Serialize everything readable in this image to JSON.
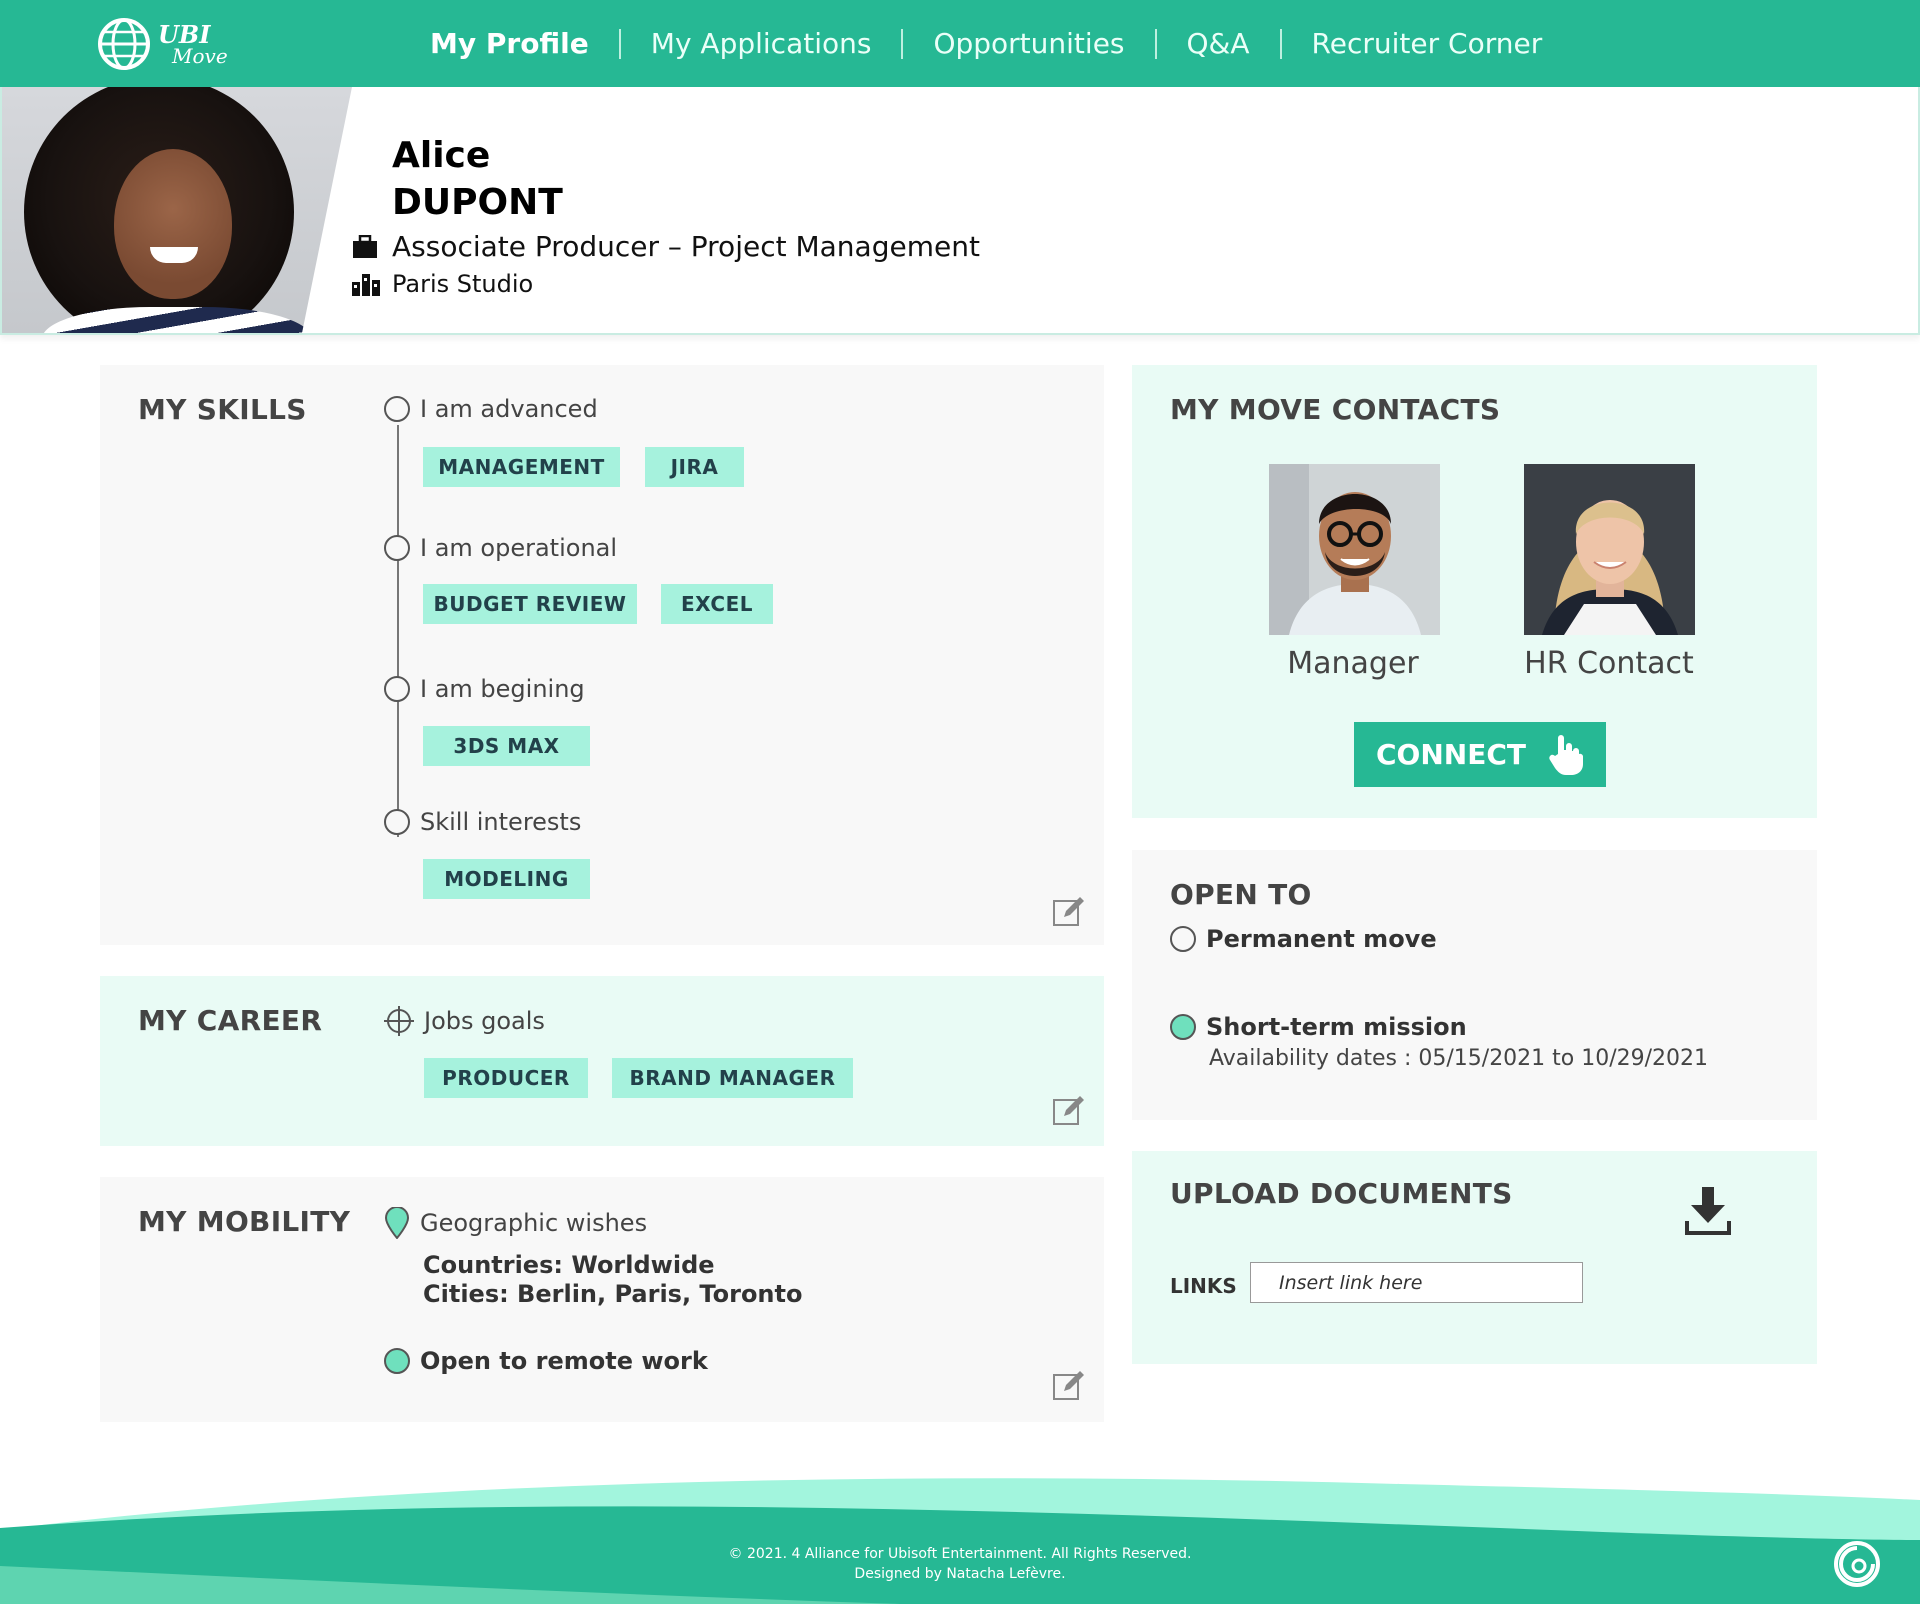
{
  "brand": {
    "logo_line1": "UBI",
    "logo_line2": "Move"
  },
  "nav": {
    "items": [
      "My Profile",
      "My Applications",
      "Opportunities",
      "Q&A",
      "Recruiter Corner"
    ]
  },
  "profile": {
    "first_name": "Alice",
    "last_name": "DUPONT",
    "role": "Associate Producer – Project Management",
    "studio": "Paris Studio"
  },
  "skills": {
    "title": "MY SKILLS",
    "levels": [
      {
        "label": "I am advanced",
        "tags": [
          "MANAGEMENT",
          "JIRA"
        ]
      },
      {
        "label": "I am operational",
        "tags": [
          "BUDGET REVIEW",
          "EXCEL"
        ]
      },
      {
        "label": "I am begining",
        "tags": [
          "3DS MAX"
        ]
      },
      {
        "label": "Skill interests",
        "tags": [
          "MODELING"
        ]
      }
    ]
  },
  "career": {
    "title": "MY CAREER",
    "goal_label": "Jobs goals",
    "tags": [
      "PRODUCER",
      "BRAND MANAGER"
    ]
  },
  "mobility": {
    "title": "MY MOBILITY",
    "geo_label": "Geographic wishes",
    "countries": "Countries: Worldwide",
    "cities": "Cities: Berlin, Paris, Toronto",
    "remote": "Open to remote work"
  },
  "contacts": {
    "title": "MY MOVE CONTACTS",
    "people": [
      {
        "label": "Manager"
      },
      {
        "label": "HR Contact"
      }
    ],
    "connect_label": "CONNECT"
  },
  "open_to": {
    "title": "OPEN TO",
    "permanent": "Permanent move",
    "short_term": "Short-term mission",
    "availability": "Availability dates : 05/15/2021 to 10/29/2021"
  },
  "upload": {
    "title": "UPLOAD DOCUMENTS",
    "links_label": "LINKS",
    "link_placeholder": "Insert link here"
  },
  "footer": {
    "line1": "© 2021. 4 Alliance for Ubisoft Entertainment. All Rights Reserved.",
    "line2": "Designed by Natacha Lefèvre."
  },
  "colors": {
    "primary": "#26b894",
    "tag": "#a6f2dd",
    "mint_bg": "#e9fbf5",
    "grey_bg": "#f8f8f8"
  }
}
